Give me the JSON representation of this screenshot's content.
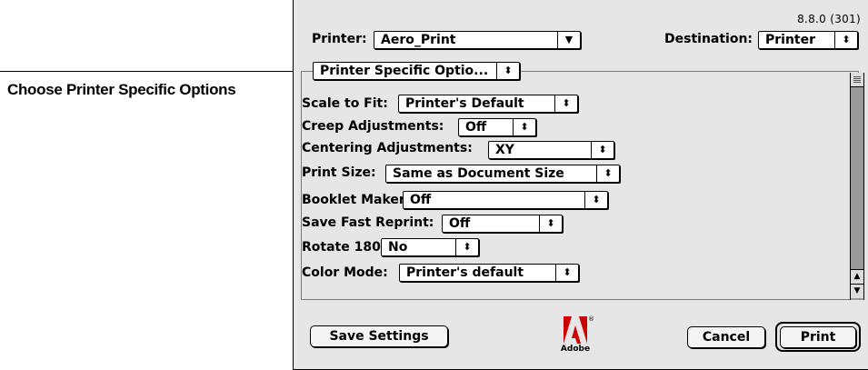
{
  "callout": {
    "label": "Choose Printer Specific Options"
  },
  "dialog": {
    "version": "8.8.0 (301)",
    "printer": {
      "label": "Printer:",
      "value": "Aero_Print"
    },
    "destination": {
      "label": "Destination:",
      "value": "Printer"
    },
    "section_popup": {
      "value": "Printer Specific Optio..."
    },
    "options": [
      {
        "label": "Scale to Fit:",
        "value": "Printer's Default"
      },
      {
        "label": "Creep Adjustments:",
        "value": "Off"
      },
      {
        "label": "Centering Adjustments:",
        "value": "XY"
      },
      {
        "label": "Print Size:",
        "value": "Same as Document Size"
      },
      {
        "label": "Booklet Maker:",
        "value": "Off"
      },
      {
        "label": "Save Fast Reprint:",
        "value": "Off"
      },
      {
        "label": "Rotate 180:",
        "value": "No"
      },
      {
        "label": "Color Mode:",
        "value": "Printer's default"
      }
    ],
    "buttons": {
      "save_settings": "Save Settings",
      "cancel": "Cancel",
      "print": "Print"
    },
    "logo": {
      "text": "Adobe",
      "mark": "A",
      "icon": "adobe-logo-icon",
      "color": "#cc0000"
    },
    "popup_arrow": "◆",
    "accent_color": "#5a5aa0"
  }
}
